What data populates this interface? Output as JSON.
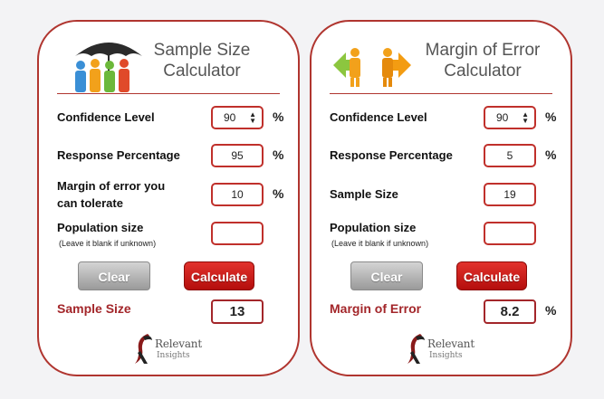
{
  "sample_size_calculator": {
    "title_line1": "Sample Size",
    "title_line2": "Calculator",
    "icon": "umbrella-people-icon",
    "confidence_label": "Confidence Level",
    "confidence_value": "90",
    "response_label": "Response Percentage",
    "response_value": "95",
    "margin_label_line1": "Margin of error you",
    "margin_label_line2": "can tolerate",
    "margin_value": "10",
    "population_label": "Population size",
    "population_note": "(Leave it blank if unknown)",
    "population_value": "",
    "percent_sign": "%",
    "clear_label": "Clear",
    "calculate_label": "Calculate",
    "result_label": "Sample Size",
    "result_value": "13",
    "logo_text": "Relevant",
    "logo_subtext": "Insights"
  },
  "margin_of_error_calculator": {
    "title_line1": "Margin of Error",
    "title_line2": "Calculator",
    "icon": "arrows-person-icon",
    "confidence_label": "Confidence Level",
    "confidence_value": "90",
    "response_label": "Response Percentage",
    "response_value": "5",
    "sample_label": "Sample Size",
    "sample_value": "19",
    "population_label": "Population size",
    "population_note": "(Leave it blank if unknown)",
    "population_value": "",
    "percent_sign": "%",
    "clear_label": "Clear",
    "calculate_label": "Calculate",
    "result_label": "Margin of Error",
    "result_value": "8.2",
    "logo_text": "Relevant",
    "logo_subtext": "Insights"
  },
  "colors": {
    "accent_red": "#b0352f",
    "button_red": "#d1201c",
    "result_red": "#a3262a",
    "clear_gray": "#b5b5b5"
  }
}
